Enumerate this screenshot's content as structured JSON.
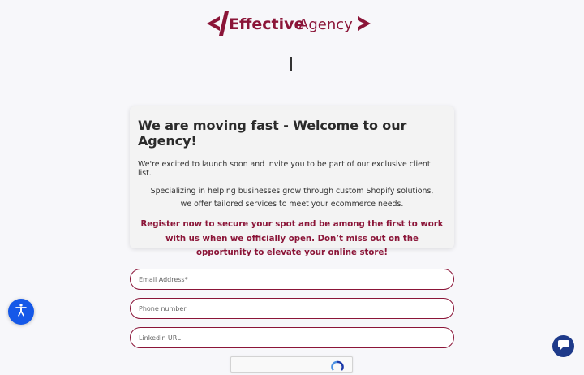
{
  "brand": {
    "name_bold": "Effective",
    "name_light": "Agency",
    "color": "#8b1538"
  },
  "card": {
    "heading": "We are moving fast - Welcome to our Agency!",
    "intro": "We're excited to launch soon and invite you to be part of our exclusive client list.",
    "specialty": "Specializing in helping businesses grow through custom Shopify solutions, we offer tailored services to meet your ecommerce needs.",
    "cta": "Register now to secure your spot and be among the first to work with us when we officially open. Don’t miss out on the opportunity to elevate your online store!"
  },
  "form": {
    "email_placeholder": "Email Address*",
    "phone_placeholder": "Phone number",
    "linkedin_placeholder": "Linkedin URL"
  },
  "icons": {
    "accessibility": "accessibility-icon",
    "chat": "chat-icon",
    "recaptcha": "recaptcha-icon"
  },
  "colors": {
    "accent": "#8b1538",
    "accessibility_button": "#1558e8",
    "chat_button": "#1e3a8a"
  }
}
